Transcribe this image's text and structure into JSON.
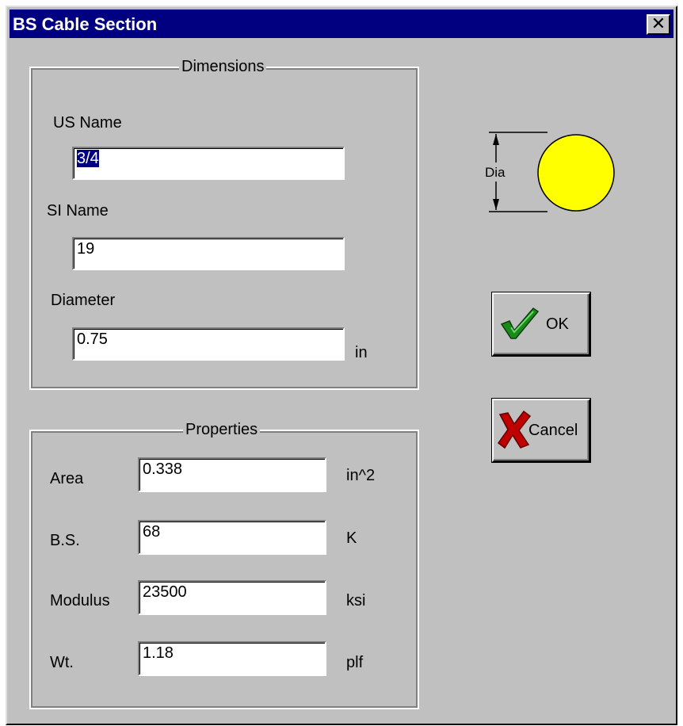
{
  "window": {
    "title": "BS Cable Section",
    "close_glyph": "✕"
  },
  "dimensions": {
    "caption": "Dimensions",
    "us_name": {
      "label": "US Name",
      "value": "3/4"
    },
    "si_name": {
      "label": "SI Name",
      "value": "19"
    },
    "diameter": {
      "label": "Diameter",
      "value": "0.75",
      "unit": "in"
    }
  },
  "properties": {
    "caption": "Properties",
    "area": {
      "label": "Area",
      "value": "0.338",
      "unit": "in^2"
    },
    "bs": {
      "label": "B.S.",
      "value": "68",
      "unit": "K"
    },
    "modulus": {
      "label": "Modulus",
      "value": "23500",
      "unit": "ksi"
    },
    "wt": {
      "label": "Wt.",
      "value": "1.18",
      "unit": "plf"
    }
  },
  "diagram": {
    "dim_label": "Dia",
    "circle_color": "#ffff00"
  },
  "buttons": {
    "ok": "OK",
    "cancel": "Cancel",
    "ok_icon_color": "#1a8a1a",
    "cancel_icon_color": "#c00000"
  }
}
